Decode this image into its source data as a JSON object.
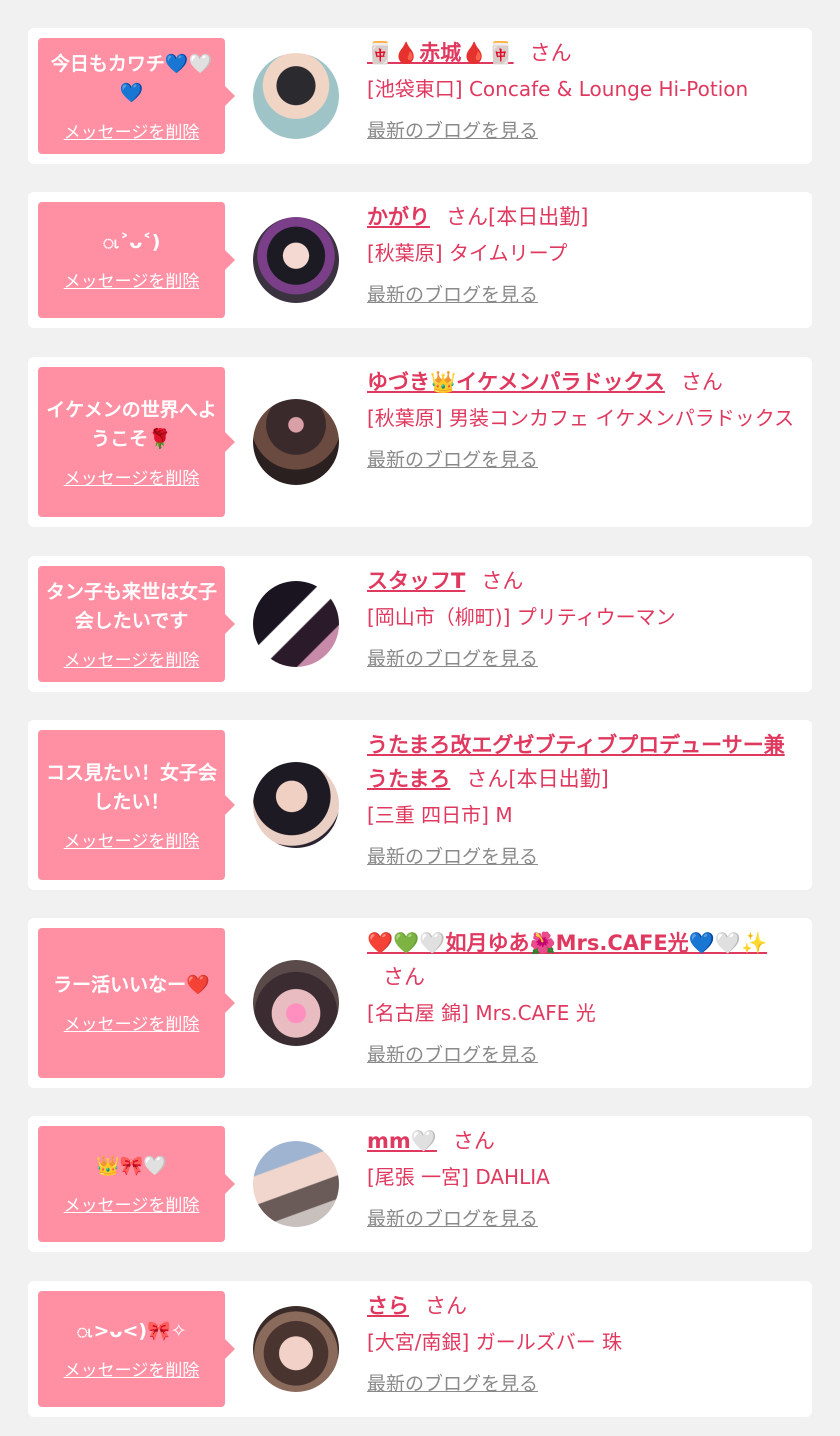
{
  "colors": {
    "background": "#f1f1f1",
    "card": "#ffffff",
    "bubble": "#ff8fa3",
    "accent": "#e0395f",
    "muted": "#8a8a8a"
  },
  "items": [
    {
      "message": "今日もカワチ💙🤍💙",
      "delete_label": "メッセージを削除",
      "cast_name": "🀄🩸赤城🩸🀄",
      "honorific": "さん",
      "shop": "[池袋東口] Concafe & Lounge Hi-Potion",
      "blog_label": "最新のブログを見る",
      "avatar_icon": "avatar-photo"
    },
    {
      "message": "ၬ˃ᴗ˂)",
      "delete_label": "メッセージを削除",
      "cast_name": "かがり",
      "honorific": "さん[本日出勤]",
      "shop": "[秋葉原] タイムリープ",
      "blog_label": "最新のブログを見る",
      "avatar_icon": "avatar-photo"
    },
    {
      "message": "イケメンの世界へようこそ🌹",
      "delete_label": "メッセージを削除",
      "cast_name": "ゆづき👑イケメンパラドックス",
      "honorific": "さん",
      "shop": "[秋葉原] 男装コンカフェ イケメンパラドックス",
      "blog_label": "最新のブログを見る",
      "avatar_icon": "avatar-photo"
    },
    {
      "message": "タン子も来世は女子会したいです",
      "delete_label": "メッセージを削除",
      "cast_name": "スタッフT",
      "honorific": "さん",
      "shop": "[岡山市（柳町)] プリティウーマン",
      "blog_label": "最新のブログを見る",
      "avatar_icon": "avatar-photo"
    },
    {
      "message": "コス見たい！女子会したい！",
      "delete_label": "メッセージを削除",
      "cast_name": "うたまろ改エグゼブティブプロデューサー兼うたまろ",
      "honorific": "さん[本日出勤]",
      "shop": "[三重 四日市] M",
      "blog_label": "最新のブログを見る",
      "avatar_icon": "avatar-photo"
    },
    {
      "message": "ラー活いいなー❤️",
      "delete_label": "メッセージを削除",
      "cast_name": "❤️💚🤍如月ゆあ🌺Mrs.CAFE光💙🤍✨",
      "honorific": "さん",
      "shop": "[名古屋 錦] Mrs.CAFE 光",
      "blog_label": "最新のブログを見る",
      "avatar_icon": "avatar-photo"
    },
    {
      "message": "👑🎀🤍",
      "delete_label": "メッセージを削除",
      "cast_name": "mm🤍",
      "honorific": "さん",
      "shop": "[尾張 一宮] DAHLIA",
      "blog_label": "最新のブログを見る",
      "avatar_icon": "avatar-photo"
    },
    {
      "message": "ၬ>ᴗ<)🎀✧",
      "delete_label": "メッセージを削除",
      "cast_name": "さら",
      "honorific": "さん",
      "shop": "[大宮/南銀] ガールズバー 珠",
      "blog_label": "最新のブログを見る",
      "avatar_icon": "avatar-photo"
    }
  ]
}
